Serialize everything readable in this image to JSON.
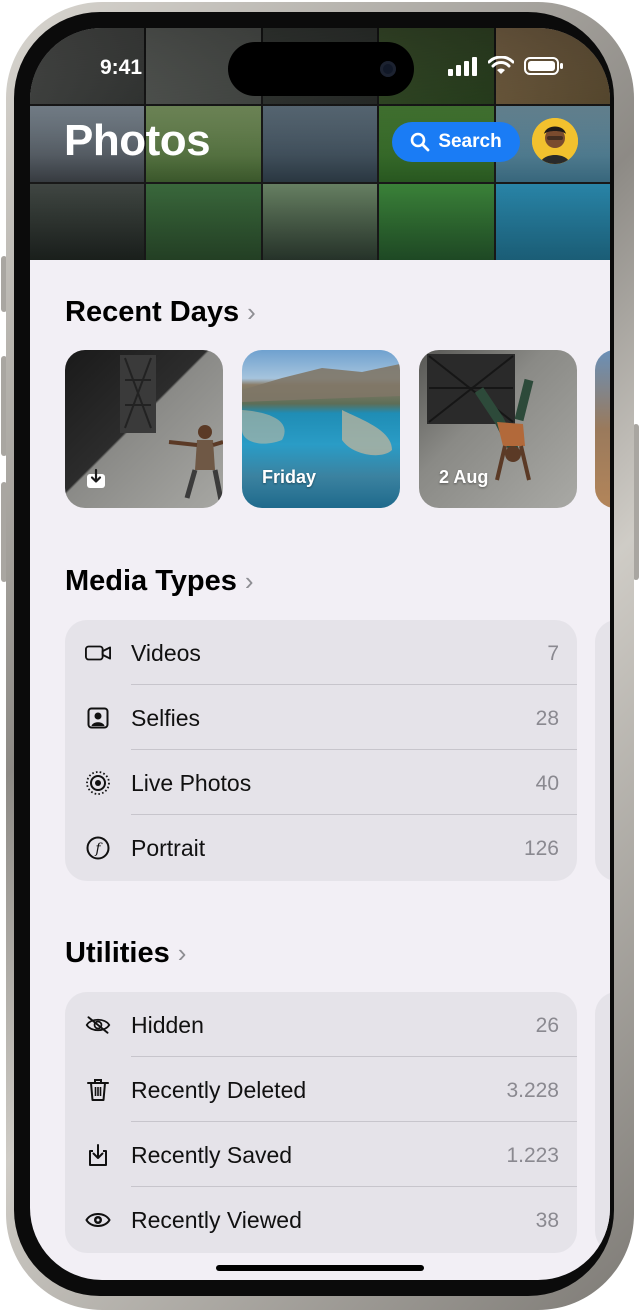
{
  "status": {
    "time": "9:41"
  },
  "header": {
    "title": "Photos",
    "search_label": "Search"
  },
  "recent_days": {
    "title": "Recent Days",
    "cards": [
      {
        "label": ""
      },
      {
        "label": "Friday"
      },
      {
        "label": "2 Aug"
      }
    ]
  },
  "media_types": {
    "title": "Media Types",
    "items": [
      {
        "icon": "video-camera-icon",
        "label": "Videos",
        "count": "7"
      },
      {
        "icon": "selfie-portrait-icon",
        "label": "Selfies",
        "count": "28"
      },
      {
        "icon": "live-photo-icon",
        "label": "Live Photos",
        "count": "40"
      },
      {
        "icon": "portrait-f-icon",
        "label": "Portrait",
        "count": "126"
      }
    ]
  },
  "utilities": {
    "title": "Utilities",
    "items": [
      {
        "icon": "eye-slash-icon",
        "label": "Hidden",
        "count": "26"
      },
      {
        "icon": "trash-icon",
        "label": "Recently Deleted",
        "count": "3.228"
      },
      {
        "icon": "tray-download-icon",
        "label": "Recently Saved",
        "count": "1.223"
      },
      {
        "icon": "eye-icon",
        "label": "Recently Viewed",
        "count": "38"
      }
    ]
  },
  "colors": {
    "accent": "#1a7cf5",
    "background": "#f2eff5",
    "group_bg": "#e5e3e9",
    "secondary_text": "#8a8990"
  }
}
